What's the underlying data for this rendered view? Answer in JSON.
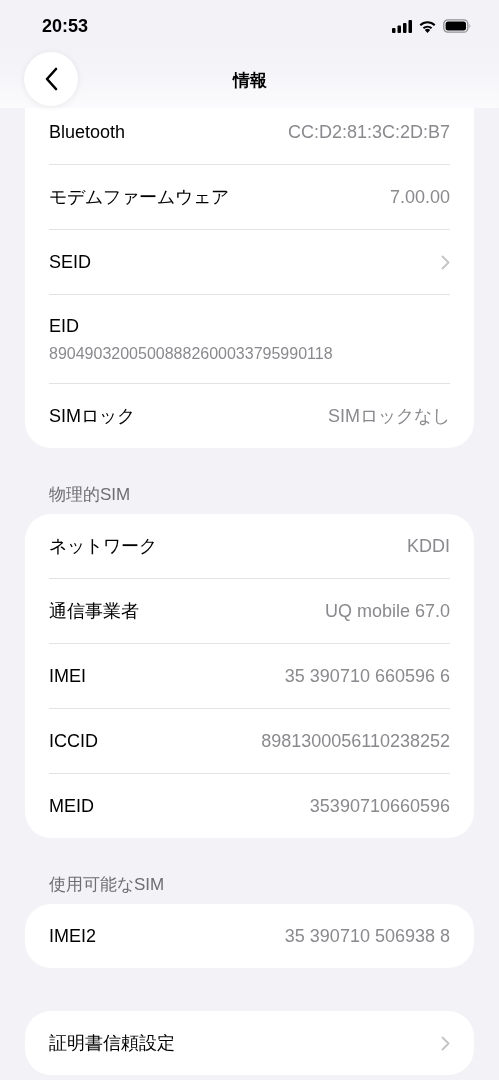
{
  "status_bar": {
    "time": "20:53"
  },
  "header": {
    "title": "情報"
  },
  "sections": [
    {
      "rows": [
        {
          "kind": "value",
          "label": "Bluetooth",
          "value": "CC:D2:81:3C:2D:B7"
        },
        {
          "kind": "value",
          "label": "モデムファームウェア",
          "value": "7.00.00"
        },
        {
          "kind": "chevron",
          "label": "SEID"
        },
        {
          "kind": "stacked",
          "label": "EID",
          "value": "89049032005008882600033795990118"
        },
        {
          "kind": "value",
          "label": "SIMロック",
          "value": "SIMロックなし"
        }
      ]
    },
    {
      "title": "物理的SIM",
      "rows": [
        {
          "kind": "value",
          "label": "ネットワーク",
          "value": "KDDI"
        },
        {
          "kind": "value",
          "label": "通信事業者",
          "value": "UQ mobile 67.0"
        },
        {
          "kind": "value",
          "label": "IMEI",
          "value": "35 390710 660596 6"
        },
        {
          "kind": "value",
          "label": "ICCID",
          "value": "8981300056110238252"
        },
        {
          "kind": "value",
          "label": "MEID",
          "value": "35390710660596"
        }
      ]
    },
    {
      "title": "使用可能なSIM",
      "rows": [
        {
          "kind": "value",
          "label": "IMEI2",
          "value": "35 390710 506938 8"
        }
      ]
    },
    {
      "rows": [
        {
          "kind": "chevron",
          "label": "証明書信頼設定"
        }
      ]
    }
  ]
}
